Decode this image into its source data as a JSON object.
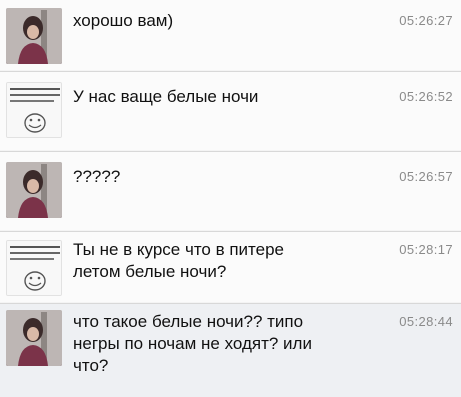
{
  "messages": [
    {
      "text": "хорошо вам)",
      "time": "05:26:27"
    },
    {
      "text": "У нас ваще белые ночи",
      "time": "05:26:52"
    },
    {
      "text": "?????",
      "time": "05:26:57"
    },
    {
      "text": "Ты не в курсе что в питере\nлетом белые ночи?",
      "time": "05:28:17"
    },
    {
      "text": "что такое белые ночи?? типо\nнегры по ночам не ходят? или\nчто?",
      "time": "05:28:44"
    }
  ],
  "avatars": {
    "photo_icon": "user-photo-icon",
    "meme_icon": "troll-face-icon"
  },
  "colors": {
    "row_light": "#fbfbfb",
    "row_grey": "#eef0f3",
    "time": "#8a8a8a"
  }
}
